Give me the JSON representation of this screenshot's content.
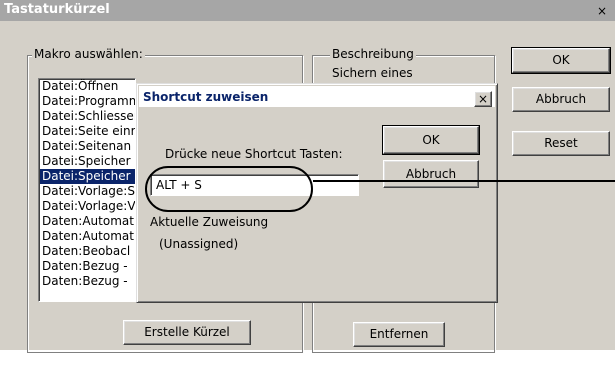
{
  "window": {
    "title": "Tastaturkürzel",
    "close_glyph": "×"
  },
  "macro_group": {
    "label": "Makro auswählen:",
    "items": [
      "Datei:Öffnen",
      "Datei:Programm",
      "Datei:Schliessen",
      "Datei:Seite einr",
      "Datei:Seitenan",
      "Datei:Speicher",
      "Datei:Speicher",
      "Datei:Vorlage:S",
      "Datei:Vorlage:V",
      "Daten:Automat",
      "Daten:Automat",
      "Daten:Beobacl",
      "Daten:Bezug -",
      "Daten:Bezug -"
    ],
    "selected_index": 6,
    "create_button": "Erstelle Kürzel"
  },
  "description_group": {
    "label": "Beschreibung",
    "text": "Sichern eines",
    "remove_button": "Entfernen"
  },
  "buttons": {
    "ok": "OK",
    "cancel": "Abbruch",
    "reset": "Reset"
  },
  "dialog": {
    "title": "Shortcut zuweisen",
    "close_glyph": "×",
    "prompt": "Drücke neue Shortcut Tasten:",
    "input_value": "ALT + S",
    "ok": "OK",
    "cancel": "Abbruch",
    "current_label": "Aktuelle Zuweisung",
    "current_value": "(Unassigned)"
  }
}
